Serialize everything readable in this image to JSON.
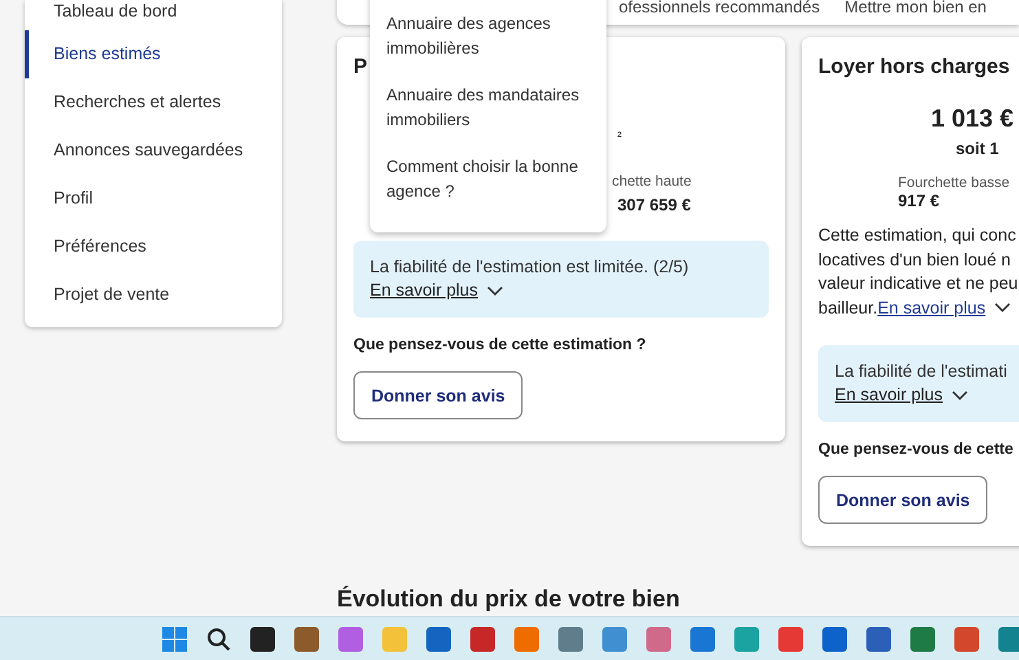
{
  "sidebar": {
    "items": [
      {
        "label": "Tableau de bord",
        "selected": false
      },
      {
        "label": "Biens estimés",
        "selected": true
      },
      {
        "label": "Recherches et alertes",
        "selected": false
      },
      {
        "label": "Annonces sauvegardées",
        "selected": false
      },
      {
        "label": "Profil",
        "selected": false
      },
      {
        "label": "Préférences",
        "selected": false
      },
      {
        "label": "Projet de vente",
        "selected": false
      }
    ]
  },
  "top_nav": {
    "items": [
      "ofessionnels recommandés",
      "Mettre mon bien en"
    ]
  },
  "dropdown": {
    "items": [
      "Annuaire des agences immobilières",
      "Annuaire des mandataires immobiliers",
      "Comment choisir la bonne agence ?"
    ]
  },
  "sale_card": {
    "title": "P",
    "superscript": "²",
    "range_label": "chette haute",
    "range_value": "307 659 €",
    "reliability": {
      "text": "La fiabilité de l'estimation est limitée. (2/5)",
      "link": "En savoir plus"
    },
    "question": "Que pensez-vous de cette estimation ?",
    "button": "Donner son avis"
  },
  "rent_card": {
    "title": "Loyer hors charges",
    "amount": "1 013 €",
    "sub_amount": "soit 1",
    "range_label": "Fourchette basse",
    "range_value": "917 €",
    "paragraph_lines": [
      "Cette estimation, qui conc",
      "locatives d'un bien loué n",
      "valeur indicative et ne peu"
    ],
    "paragraph_last": "bailleur.",
    "paragraph_link": "En savoir plus",
    "reliability": {
      "text": "La fiabilité de l'estimati",
      "link": "En savoir plus"
    },
    "question": "Que pensez-vous de cette",
    "button": "Donner son avis"
  },
  "section_heading": "Évolution du prix de votre bien"
}
